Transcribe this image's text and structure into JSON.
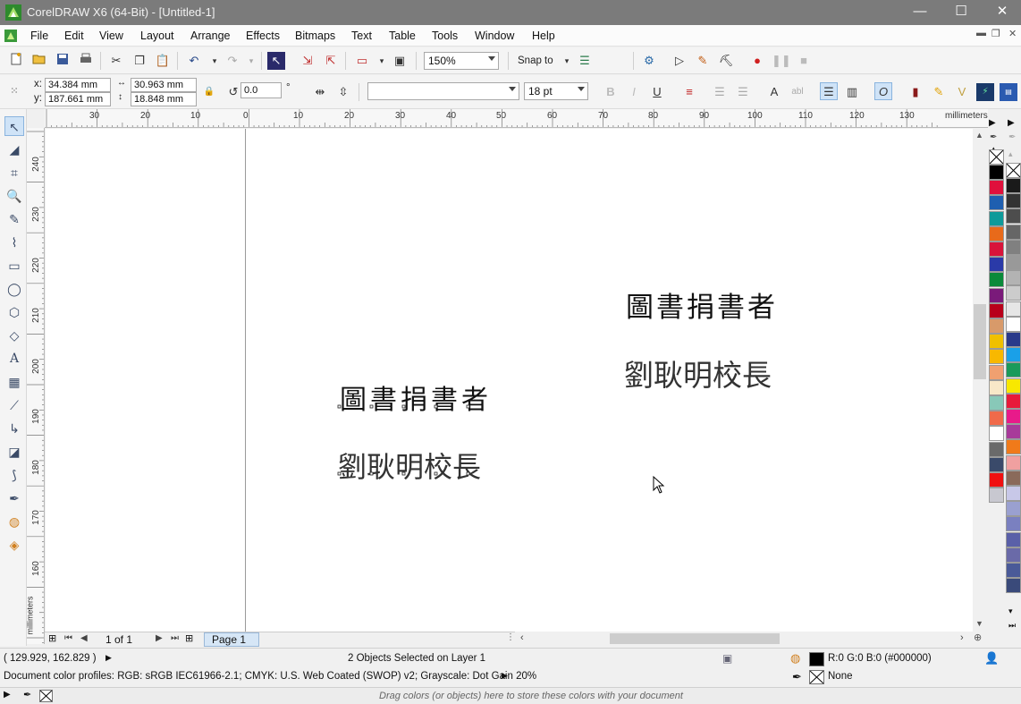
{
  "window": {
    "title": "CorelDRAW X6 (64-Bit) - [Untitled-1]",
    "minimize": "—",
    "maximize": "☐",
    "close": "✕"
  },
  "menu": [
    "File",
    "Edit",
    "View",
    "Layout",
    "Arrange",
    "Effects",
    "Bitmaps",
    "Text",
    "Table",
    "Tools",
    "Window",
    "Help"
  ],
  "standard_toolbar": {
    "zoom": "150%",
    "snap_to": "Snap to"
  },
  "property_bar": {
    "x_label": "x:",
    "x": "34.384 mm",
    "y_label": "y:",
    "y": "187.661 mm",
    "width": "30.963 mm",
    "height": "18.848 mm",
    "angle": "0.0",
    "angle_unit": "°",
    "font_name": "",
    "font_size": "18 pt"
  },
  "ruler": {
    "units": "millimeters",
    "top_labels": [
      "30",
      "20",
      "10",
      "0",
      "10",
      "20",
      "30",
      "40",
      "50",
      "60",
      "70",
      "80",
      "90",
      "100",
      "110",
      "120",
      "130"
    ],
    "left_labels": [
      "240",
      "230",
      "220",
      "210",
      "200",
      "190",
      "180",
      "170",
      "160"
    ],
    "left_units": "millimeters"
  },
  "canvas": {
    "text_objects": [
      {
        "line1": "圖書捐書者",
        "line2": "劉耿明校長"
      },
      {
        "line1": "圖書捐書者",
        "line2": "劉耿明校長"
      }
    ]
  },
  "page_nav": {
    "page_count": "1 of 1",
    "page_tab": "Page 1"
  },
  "status": {
    "coords": "( 129.929, 162.829 )",
    "selection": "2 Objects Selected on Layer 1",
    "fill_color": "R:0 G:0 B:0 (#000000)",
    "outline": "None",
    "profiles": "Document color profiles: RGB: sRGB IEC61966-2.1; CMYK: U.S. Web Coated (SWOP) v2; Grayscale: Dot Gain 20%",
    "doc_palette_hint": "Drag colors (or objects) here to store these colors with your document"
  },
  "palette_colors": [
    "#000000",
    "#e0103c",
    "#1f5fb0",
    "#0e9a9a",
    "#e86a1a",
    "#d8143a",
    "#2a3aa8",
    "#0a8a3a",
    "#7a1a7a",
    "#b8001a",
    "#d89a6a",
    "#f0c000",
    "#f8b800",
    "#f0a070",
    "#f8e8c8",
    "#88c8b8",
    "#f06a4a",
    "#ffffff",
    "#6a6a6a",
    "#3a4a6a",
    "#f01010",
    "#c8c8d0"
  ],
  "gray_palette": [
    "#1a1a1a",
    "#333333",
    "#4d4d4d",
    "#666666",
    "#808080",
    "#999999",
    "#b3b3b3",
    "#cccccc",
    "#e6e6e6",
    "#ffffff",
    "#2a3a8a",
    "#1aa0e8",
    "#1a9a5a",
    "#f8e800",
    "#e81a3a",
    "#e81a8a",
    "#a83a9a",
    "#f07a1a",
    "#f0a0a0",
    "#8a6a5a",
    "#c8c8e8",
    "#9aa0d0",
    "#7a80c0",
    "#5a60a8",
    "#6a6aa8",
    "#4a5a98",
    "#3a4a7a"
  ],
  "colors": {
    "titlebar": "#7b7b7b",
    "page_tab": "#d6e6f6"
  }
}
